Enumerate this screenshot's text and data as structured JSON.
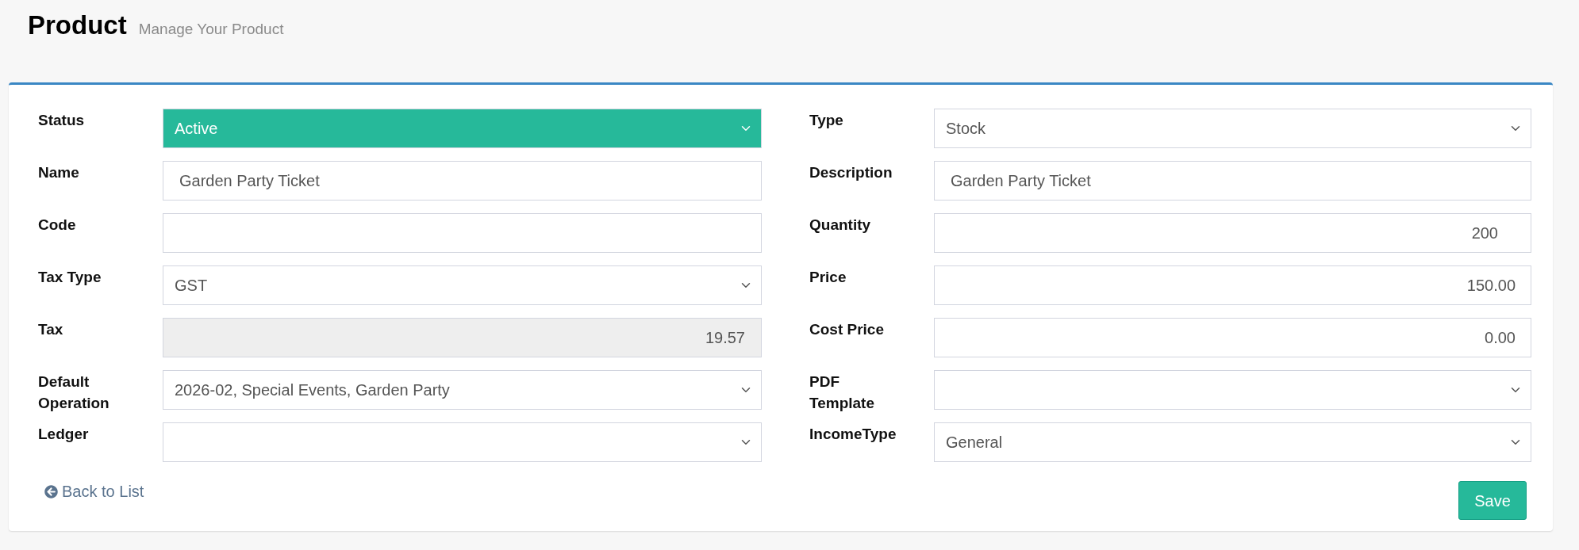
{
  "header": {
    "title": "Product",
    "subtitle": "Manage Your Product"
  },
  "form": {
    "left": [
      {
        "label": "Status",
        "kind": "select",
        "value": "Active",
        "color": "#26b99a"
      },
      {
        "label": "Name",
        "kind": "text",
        "value": "Garden Party Ticket"
      },
      {
        "label": "Code",
        "kind": "text"
      },
      {
        "label": "Tax Type",
        "kind": "select",
        "value": "GST"
      },
      {
        "label": "Tax",
        "kind": "readonly",
        "value": "19.57"
      },
      {
        "label": "Default Operation",
        "kind": "select",
        "value": "2026-02, Special Events, Garden Party"
      },
      {
        "label": "Ledger",
        "kind": "select"
      }
    ],
    "right": [
      {
        "label": "Type",
        "kind": "select",
        "value": "Stock"
      },
      {
        "label": "Description",
        "kind": "text",
        "value": "Garden Party Ticket"
      },
      {
        "label": "Quantity",
        "kind": "number",
        "value": "200"
      },
      {
        "label": "Price",
        "kind": "amount",
        "value": "150.00"
      },
      {
        "label": "Cost Price",
        "kind": "amount",
        "value": "0.00"
      },
      {
        "label": "PDF Template",
        "kind": "select"
      },
      {
        "label": "IncomeType",
        "kind": "select",
        "value": "General"
      }
    ]
  },
  "footer": {
    "back_link": "Back to List",
    "save_button": "Save"
  }
}
